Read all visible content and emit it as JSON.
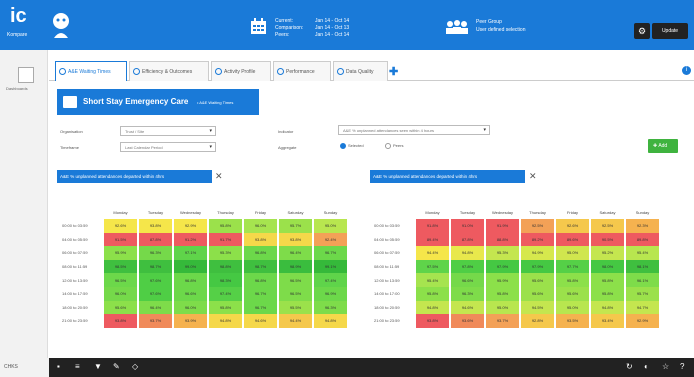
{
  "app": {
    "logo": "ic",
    "logo_sub": "Kompare"
  },
  "header": {
    "current_label": "Current:",
    "current_value": "Jan 14 - Oct 14",
    "comparison_label": "Comparison:",
    "comparison_value": "Jan 14 - Oct 13",
    "peers_label": "Peers:",
    "peers_value": "Jan 14 - Oct 14",
    "peer_title": "Peer Group",
    "peer_sub": "User defined selection",
    "update_label": "Update"
  },
  "sidebar": {
    "dashboard_label": "Dashboards",
    "footer": "CHKS"
  },
  "tabs": [
    {
      "label": "A&E Waiting Times"
    },
    {
      "label": "Efficiency & Outcomes"
    },
    {
      "label": "Activity Profile"
    },
    {
      "label": "Performance"
    },
    {
      "label": "Data Quality"
    }
  ],
  "banner": {
    "title": "Short Stay Emergency Care",
    "sub": "• A&E Waiting Times"
  },
  "filters": {
    "organisation_label": "Organisation",
    "organisation_value": "Trust / Site",
    "timeframe_label": "Timeframe",
    "timeframe_value": "Last Calendar Period",
    "indicator_label": "Indicator",
    "indicator_value": "A&E % unplanned attendances seen within 4 hours",
    "aggregate_label": "Aggregate",
    "radio1": "Selected",
    "radio2": "Peers",
    "add_label": "Add"
  },
  "chips": [
    "A&E % unplanned attendances departed within 4hrs",
    "A&E % unplanned attendances departed within 4hrs"
  ],
  "days": [
    "Monday",
    "Tuesday",
    "Wednesday",
    "Thursday",
    "Friday",
    "Saturday",
    "Sunday"
  ],
  "left_table": {
    "rows": [
      "00:00 to 03:59",
      "04:00 to 05:59",
      "06:00 to 07:59",
      "08:00 to 11:59",
      "12:00 to 13:59",
      "14:00 to 17:59",
      "18:00 to 20:59",
      "21:00 to 23:59"
    ],
    "cells": [
      [
        "92.6%",
        "93.8%",
        "92.9%",
        "95.8%",
        "96.0%",
        "95.7%",
        "95.0%"
      ],
      [
        "91.5%",
        "87.8%",
        "91.2%",
        "91.7%",
        "93.8%",
        "93.8%",
        "92.4%"
      ],
      [
        "95.9%",
        "96.3%",
        "97.1%",
        "95.3%",
        "96.8%",
        "96.4%",
        "96.7%"
      ],
      [
        "98.5%",
        "98.7%",
        "99.0%",
        "98.8%",
        "98.7%",
        "98.9%",
        "99.1%"
      ],
      [
        "96.5%",
        "97.6%",
        "96.8%",
        "98.3%",
        "96.8%",
        "96.5%",
        "97.4%"
      ],
      [
        "96.0%",
        "97.6%",
        "96.6%",
        "97.4%",
        "96.7%",
        "96.5%",
        "96.9%"
      ],
      [
        "95.6%",
        "96.4%",
        "96.0%",
        "95.8%",
        "96.7%",
        "95.5%",
        "96.3%"
      ],
      [
        "93.8%",
        "93.7%",
        "93.9%",
        "94.8%",
        "94.6%",
        "94.4%",
        "94.8%"
      ]
    ],
    "colors": [
      [
        "#f5e64a",
        "#f5e64a",
        "#f5e64a",
        "#9be14b",
        "#a6e44f",
        "#9be14b",
        "#b8e64f"
      ],
      [
        "#ee5a60",
        "#ee5a60",
        "#ee5a60",
        "#ee5a60",
        "#f5d84a",
        "#f5d84a",
        "#f3a157"
      ],
      [
        "#8ce04a",
        "#75d94a",
        "#5fd44a",
        "#8ce04a",
        "#6cd84a",
        "#7edc4a",
        "#6cd84a"
      ],
      [
        "#3fbf3f",
        "#3fbf3f",
        "#35b93a",
        "#3fbf3f",
        "#3fbf3f",
        "#3abd3e",
        "#35b93a"
      ],
      [
        "#6cd84a",
        "#4fce45",
        "#6cd84a",
        "#45c843",
        "#6cd84a",
        "#7edc4a",
        "#5fd44a"
      ],
      [
        "#75d94a",
        "#4fce45",
        "#6cd84a",
        "#55d047",
        "#6cd84a",
        "#7edc4a",
        "#6cd84a"
      ],
      [
        "#8ce04a",
        "#7edc4a",
        "#7edc4a",
        "#8ce04a",
        "#6cd84a",
        "#9be14b",
        "#7edc4a"
      ],
      [
        "#ee5a60",
        "#f08a5a",
        "#f5b24f",
        "#f5d84a",
        "#f5d84a",
        "#f5c84c",
        "#f5d84a"
      ]
    ]
  },
  "right_table": {
    "rows": [
      "00:00 to 03:59",
      "04:00 to 05:59",
      "06:00 to 07:59",
      "08:00 to 11:59",
      "12:00 to 13:59",
      "14:00 to 17:00",
      "18:00 to 20:59",
      "21:00 to 23:59"
    ],
    "cells": [
      [
        "91.8%",
        "91.0%",
        "91.9%",
        "92.5%",
        "92.6%",
        "92.5%",
        "92.3%"
      ],
      [
        "89.4%",
        "87.8%",
        "88.8%",
        "89.2%",
        "89.6%",
        "90.5%",
        "89.8%"
      ],
      [
        "94.4%",
        "94.8%",
        "95.3%",
        "94.9%",
        "95.0%",
        "95.2%",
        "95.4%"
      ],
      [
        "97.5%",
        "97.8%",
        "97.9%",
        "97.9%",
        "97.7%",
        "98.0%",
        "98.1%"
      ],
      [
        "95.4%",
        "96.6%",
        "95.9%",
        "95.6%",
        "95.8%",
        "95.8%",
        "96.1%"
      ],
      [
        "95.8%",
        "96.3%",
        "95.8%",
        "95.6%",
        "95.6%",
        "95.8%",
        "95.7%"
      ],
      [
        "94.8%",
        "94.6%",
        "95.0%",
        "94.5%",
        "95.0%",
        "94.8%",
        "94.7%"
      ],
      [
        "93.8%",
        "93.6%",
        "93.7%",
        "92.8%",
        "93.5%",
        "93.4%",
        "92.9%"
      ]
    ],
    "colors": [
      [
        "#ee5a60",
        "#ee5a60",
        "#ee5a60",
        "#f3a157",
        "#f5c84c",
        "#f5c84c",
        "#f5b24f"
      ],
      [
        "#ee5a60",
        "#ee5a60",
        "#ee5a60",
        "#ee5a60",
        "#ee5a60",
        "#ee5a60",
        "#ee5a60"
      ],
      [
        "#f5e64a",
        "#e8e84c",
        "#c4e64f",
        "#d6e84d",
        "#d0e64e",
        "#c4e64f",
        "#b8e64f"
      ],
      [
        "#5fd44a",
        "#4fce45",
        "#45c843",
        "#45c843",
        "#55d047",
        "#45c843",
        "#3fbf3f"
      ],
      [
        "#a6e44f",
        "#75d94a",
        "#8ce04a",
        "#9be14b",
        "#8ce04a",
        "#8ce04a",
        "#7edc4a"
      ],
      [
        "#8ce04a",
        "#7edc4a",
        "#8ce04a",
        "#9be14b",
        "#9be14b",
        "#8ce04a",
        "#9be14b"
      ],
      [
        "#c4e64f",
        "#c4e64f",
        "#b8e64f",
        "#c4e64f",
        "#b8e64f",
        "#c4e64f",
        "#c4e64f"
      ],
      [
        "#ee5a60",
        "#f08a5a",
        "#f3a157",
        "#f5c84c",
        "#f5b24f",
        "#f5c84c",
        "#f5b24f"
      ]
    ]
  }
}
